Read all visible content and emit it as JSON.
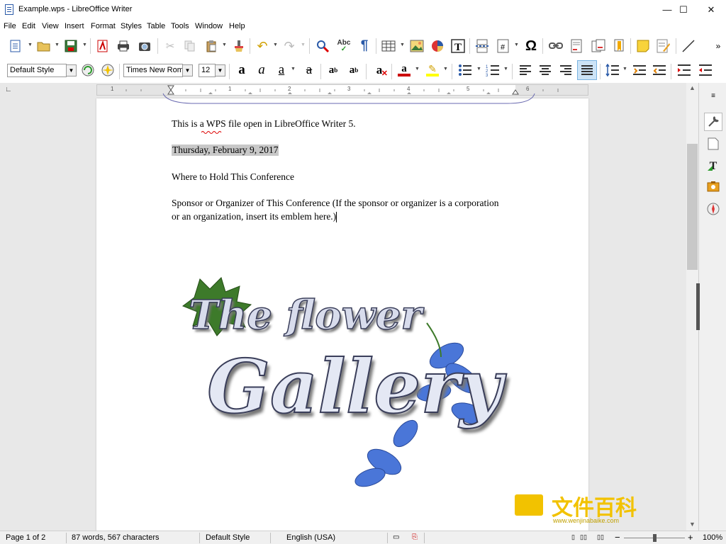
{
  "window": {
    "title": "Example.wps - LibreOffice Writer",
    "minimize": "—",
    "maximize": "☐",
    "close": "✕"
  },
  "menu": [
    "File",
    "Edit",
    "View",
    "Insert",
    "Format",
    "Styles",
    "Table",
    "Tools",
    "Window",
    "Help"
  ],
  "formatting": {
    "paragraph_style": "Default Style",
    "font_name": "Times New Roma",
    "font_size": "12"
  },
  "ruler": {
    "numbers": [
      "1",
      "1",
      "2",
      "3",
      "4",
      "5",
      "6"
    ]
  },
  "document": {
    "line1": "This is a WPS file open in LibreOffice Writer 5.",
    "date": "Thursday, February 9, 2017",
    "line3": "Where to Hold This Conference",
    "line4a": "Sponsor or Organizer of This Conference (If the sponsor or organizer is a corporation",
    "line4b": "or an organization, insert its emblem here.)",
    "emblem": {
      "line1": "The flower",
      "line2": "Gallery"
    }
  },
  "status": {
    "page": "Page 1 of 2",
    "words": "87 words, 567 characters",
    "style": "Default Style",
    "language": "English (USA)",
    "zoom": "100%",
    "zoom_level": 1.0
  },
  "watermark": {
    "text": "文件百科",
    "url": "www.wenjinabaike.com"
  }
}
